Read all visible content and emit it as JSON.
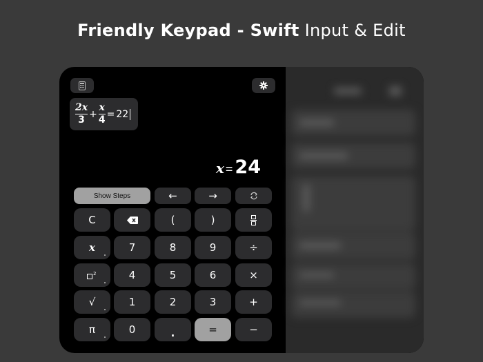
{
  "headline": {
    "bold": "Friendly Keypad - Swift",
    "regular": "Input & Edit"
  },
  "toolbar": {
    "calculator_icon": "calculator-icon",
    "settings_icon": "gear-icon"
  },
  "expression": {
    "term1_numerator": "2x",
    "term1_denominator": "3",
    "plus": "+",
    "term2_numerator": "x",
    "term2_denominator": "4",
    "equals": "=",
    "rhs": "22"
  },
  "result": {
    "variable": "x",
    "equals": "=",
    "value": "24"
  },
  "keypad": {
    "show_steps": "Show Steps",
    "left_arrow": "←",
    "right_arrow": "→",
    "swap_icon": "refresh-icon",
    "clear": "C",
    "backspace_icon": "backspace-icon",
    "open_paren": "(",
    "close_paren": ")",
    "fraction_icon": "fraction-icon",
    "variable": "x",
    "seven": "7",
    "eight": "8",
    "nine": "9",
    "divide": "÷",
    "square_icon": "square-power-icon",
    "four": "4",
    "five": "5",
    "six": "6",
    "multiply": "×",
    "sqrt": "√",
    "one": "1",
    "two": "2",
    "three": "3",
    "plus": "+",
    "pi": "π",
    "zero": "0",
    "decimal": ".",
    "equals": "=",
    "minus": "−"
  },
  "colors": {
    "background": "#3a3a3a",
    "device": "#000000",
    "key": "#2c2c2e",
    "key_light": "#a1a1a1"
  }
}
